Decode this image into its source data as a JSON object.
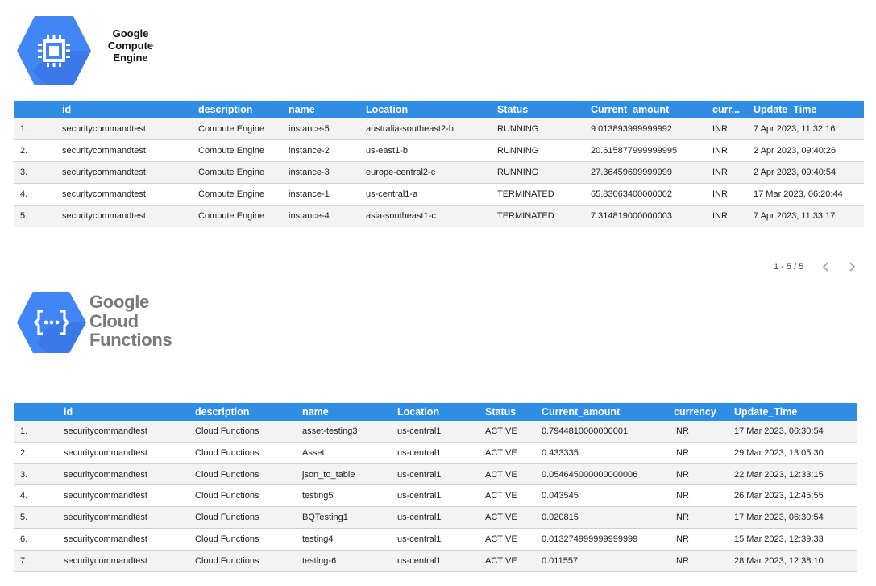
{
  "logos": {
    "compute_engine": {
      "lines": [
        "Google",
        "Compute",
        "Engine"
      ],
      "icon": "chip-icon",
      "color": "#4285f4"
    },
    "cloud_functions": {
      "lines": [
        "Google",
        "Cloud",
        "Functions"
      ],
      "icon": "functions-icon",
      "color": "#4285f4"
    }
  },
  "compute_table": {
    "columns": [
      "",
      "id",
      "description",
      "name",
      "Location",
      "Status",
      "Current_amount",
      "curr...",
      "Update_Time"
    ],
    "rows": [
      {
        "num": "1.",
        "id": "securitycommandtest",
        "description": "Compute Engine",
        "name": "instance-5",
        "location": "australia-southeast2-b",
        "status": "RUNNING",
        "amount": "9.013893999999992",
        "currency": "INR",
        "time": "7 Apr 2023, 11:32:16"
      },
      {
        "num": "2.",
        "id": "securitycommandtest",
        "description": "Compute Engine",
        "name": "instance-2",
        "location": "us-east1-b",
        "status": "RUNNING",
        "amount": "20.615877999999995",
        "currency": "INR",
        "time": "2 Apr 2023, 09:40:26"
      },
      {
        "num": "3.",
        "id": "securitycommandtest",
        "description": "Compute Engine",
        "name": "instance-3",
        "location": "europe-central2-c",
        "status": "RUNNING",
        "amount": "27.36459699999999",
        "currency": "INR",
        "time": "2 Apr 2023, 09:40:54"
      },
      {
        "num": "4.",
        "id": "securitycommandtest",
        "description": "Compute Engine",
        "name": "instance-1",
        "location": "us-central1-a",
        "status": "TERMINATED",
        "amount": "65.83063400000002",
        "currency": "INR",
        "time": "17 Mar 2023, 06:20:44"
      },
      {
        "num": "5.",
        "id": "securitycommandtest",
        "description": "Compute Engine",
        "name": "instance-4",
        "location": "asia-southeast1-c",
        "status": "TERMINATED",
        "amount": "7.314819000000003",
        "currency": "INR",
        "time": "7 Apr 2023, 11:33:17"
      }
    ],
    "pagination": {
      "label": "1 - 5 / 5",
      "prev_icon": "chevron-left-icon",
      "next_icon": "chevron-right-icon"
    }
  },
  "functions_table": {
    "columns": [
      "",
      "id",
      "description",
      "name",
      "Location",
      "Status",
      "Current_amount",
      "currency",
      "Update_Time"
    ],
    "rows": [
      {
        "num": "1.",
        "id": "securitycommandtest",
        "description": "Cloud Functions",
        "name": "asset-testing3",
        "location": "us-central1",
        "status": "ACTIVE",
        "amount": "0.7944810000000001",
        "currency": "INR",
        "time": "17 Mar 2023, 06:30:54"
      },
      {
        "num": "2.",
        "id": "securitycommandtest",
        "description": "Cloud Functions",
        "name": "Asset",
        "location": "us-central1",
        "status": "ACTIVE",
        "amount": "0.433335",
        "currency": "INR",
        "time": "29 Mar 2023, 13:05:30"
      },
      {
        "num": "3.",
        "id": "securitycommandtest",
        "description": "Cloud Functions",
        "name": "json_to_table",
        "location": "us-central1",
        "status": "ACTIVE",
        "amount": "0.054645000000000006",
        "currency": "INR",
        "time": "22 Mar 2023, 12:33:15"
      },
      {
        "num": "4.",
        "id": "securitycommandtest",
        "description": "Cloud Functions",
        "name": "testing5",
        "location": "us-central1",
        "status": "ACTIVE",
        "amount": "0.043545",
        "currency": "INR",
        "time": "26 Mar 2023, 12:45:55"
      },
      {
        "num": "5.",
        "id": "securitycommandtest",
        "description": "Cloud Functions",
        "name": "BQTesting1",
        "location": "us-central1",
        "status": "ACTIVE",
        "amount": "0.020815",
        "currency": "INR",
        "time": "17 Mar 2023, 06:30:54"
      },
      {
        "num": "6.",
        "id": "securitycommandtest",
        "description": "Cloud Functions",
        "name": "testing4",
        "location": "us-central1",
        "status": "ACTIVE",
        "amount": "0.013274999999999999",
        "currency": "INR",
        "time": "15 Mar 2023, 12:39:33"
      },
      {
        "num": "7.",
        "id": "securitycommandtest",
        "description": "Cloud Functions",
        "name": "testing-6",
        "location": "us-central1",
        "status": "ACTIVE",
        "amount": "0.011557",
        "currency": "INR",
        "time": "28 Mar 2023, 12:38:10"
      }
    ]
  },
  "colors": {
    "header_bg": "#2f8de4",
    "header_text": "#ffffff",
    "row_alt_bg": "#f3f3f3",
    "logo_blue": "#4285f4"
  }
}
